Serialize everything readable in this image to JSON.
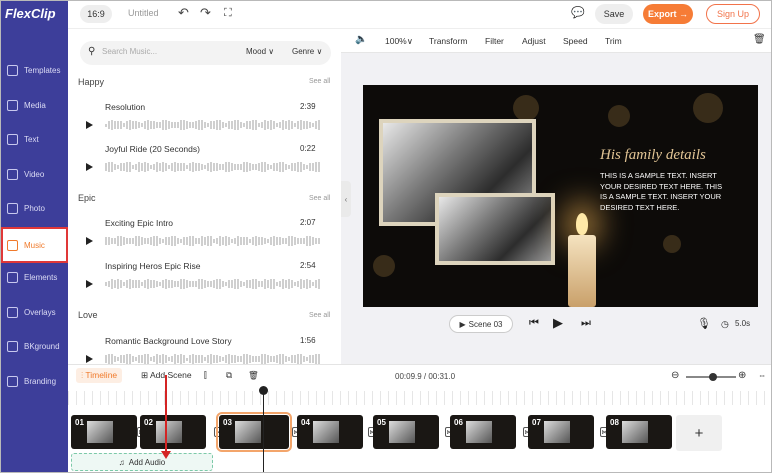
{
  "app": {
    "logo": "FlexClip"
  },
  "sidebar": {
    "items": [
      {
        "label": "Templates"
      },
      {
        "label": "Media"
      },
      {
        "label": "Text"
      },
      {
        "label": "Video"
      },
      {
        "label": "Photo"
      },
      {
        "label": "Music",
        "active": true
      },
      {
        "label": "Elements"
      },
      {
        "label": "Overlays"
      },
      {
        "label": "BKground"
      },
      {
        "label": "Branding"
      }
    ]
  },
  "topbar": {
    "ratio": "16:9",
    "project_title": "Untitled",
    "save": "Save",
    "export": "Export →",
    "signup": "Sign Up"
  },
  "music": {
    "search_placeholder": "Search Music...",
    "mood": "Mood ∨",
    "genre": "Genre ∨",
    "categories": [
      {
        "name": "Happy",
        "see_all": "See all",
        "tracks": [
          {
            "name": "Resolution",
            "duration": "2:39"
          },
          {
            "name": "Joyful Ride (20 Seconds)",
            "duration": "0:22"
          }
        ]
      },
      {
        "name": "Epic",
        "see_all": "See all",
        "tracks": [
          {
            "name": "Exciting Epic Intro",
            "duration": "2:07"
          },
          {
            "name": "Inspiring Heros Epic Rise",
            "duration": "2:54"
          }
        ]
      },
      {
        "name": "Love",
        "see_all": "See all",
        "tracks": [
          {
            "name": "Romantic Background Love Story",
            "duration": "1:56"
          }
        ]
      }
    ]
  },
  "editor_toolbar": {
    "volume_icon": "speaker-icon",
    "zoom": "100%∨",
    "transform": "Transform",
    "filter": "Filter",
    "adjust": "Adjust",
    "speed": "Speed",
    "trim": "Trim"
  },
  "canvas": {
    "title": "His family details",
    "body": "THIS IS A SAMPLE TEXT. INSERT YOUR DESIRED TEXT HERE. THIS IS A SAMPLE TEXT. INSERT YOUR DESIRED TEXT HERE."
  },
  "player": {
    "scene": "Scene 03",
    "duration": "5.0s"
  },
  "timeline": {
    "label": "Timeline",
    "add_scene": "Add Scene",
    "time": "00:09.9 / 00:31.0",
    "clips": [
      "01",
      "02",
      "03",
      "04",
      "05",
      "06",
      "07",
      "08"
    ],
    "add_clip": "+",
    "add_audio": "Add Audio"
  }
}
